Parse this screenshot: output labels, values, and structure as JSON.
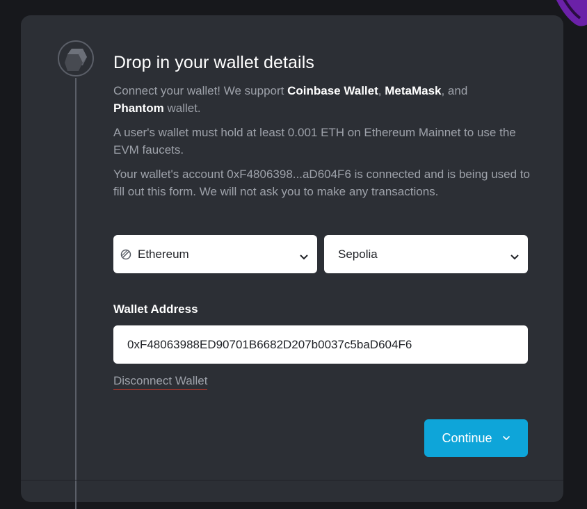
{
  "step": {
    "title": "Drop in your wallet details",
    "intro_prefix": "Connect your wallet! We support ",
    "wallet_coinbase": "Coinbase Wallet",
    "sep1": ", ",
    "wallet_metamask": "MetaMask",
    "sep2": ", and",
    "wallet_phantom": "Phantom",
    "intro_suffix": " wallet.",
    "requirement": "A user's wallet must hold at least 0.001 ETH on Ethereum Mainnet to use the EVM faucets.",
    "connected_notice": "Your wallet's account 0xF4806398...aD604F6 is connected and is being used to fill out this form. We will not ask you to make any transactions."
  },
  "network_select": {
    "value": "Ethereum",
    "icon": "ethereum-icon"
  },
  "testnet_select": {
    "value": "Sepolia"
  },
  "wallet_address": {
    "label": "Wallet Address",
    "value": "0xF48063988ED90701B6682D207b0037c5baD604F6"
  },
  "disconnect_label": "Disconnect Wallet",
  "continue_label": "Continue",
  "colors": {
    "background": "#17181c",
    "card": "#2c2f35",
    "accent": "#0ea5d9",
    "muted_text": "#9ea2aa",
    "disconnect_underline": "#c0392b",
    "blob": "#6b21a8"
  }
}
